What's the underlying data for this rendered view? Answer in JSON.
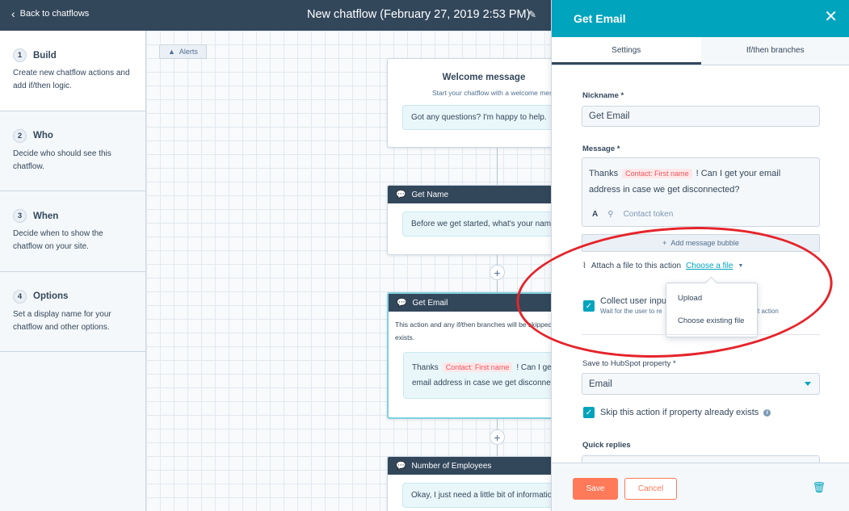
{
  "topbar": {
    "back_label": "Back to chatflows",
    "title": "New chatflow (February 27, 2019 2:53 PM)"
  },
  "steps": [
    {
      "num": "1",
      "title": "Build",
      "desc": "Create new chatflow actions and add if/then logic."
    },
    {
      "num": "2",
      "title": "Who",
      "desc": "Decide who should see this chatflow."
    },
    {
      "num": "3",
      "title": "When",
      "desc": "Decide when to show the chatflow on your site."
    },
    {
      "num": "4",
      "title": "Options",
      "desc": "Set a display name for your chatflow and other options."
    }
  ],
  "canvas": {
    "alerts_label": "Alerts",
    "welcome": {
      "title": "Welcome message",
      "subtitle": "Start your chatflow with a welcome mes",
      "bubble": "Got any questions? I'm happy to help."
    },
    "get_name": {
      "header": "Get Name",
      "bubble": "Before we get started, what's your name"
    },
    "get_email": {
      "header": "Get Email",
      "note_line1": "This action and any if/then branches will be skipped",
      "note_line2": "exists.",
      "bubble_pre": "Thanks",
      "bubble_tag": "Contact: First name",
      "bubble_post": "! Can I get",
      "bubble_line2": "email address in case we get disconnect"
    },
    "employees": {
      "header": "Number of Employees",
      "bubble": "Okay, I just need a little bit of informatio"
    }
  },
  "panel": {
    "title": "Get Email",
    "tabs": [
      "Settings",
      "If/then branches"
    ],
    "nickname_label": "Nickname *",
    "nickname_value": "Get Email",
    "message_label": "Message *",
    "message_pre": "Thanks",
    "message_tag": "Contact: First name",
    "message_post": "! Can I get your email",
    "message_line2": "address in case we get disconnected?",
    "contact_token": "Contact token",
    "add_bubble": "Add message bubble",
    "attach_label": "Attach a file to this action",
    "choose_file": "Choose a file",
    "dropdown_items": [
      "Upload",
      "Choose existing file"
    ],
    "collect_label": "Collect user inpu",
    "collect_sub": "Wait for the user to re",
    "collect_sub_tail": "t action",
    "save_property_label": "Save to HubSpot property *",
    "save_property_value": "Email",
    "skip_label": "Skip this action if property already exists",
    "quick_replies_label": "Quick replies",
    "save_button": "Save",
    "cancel_button": "Cancel"
  },
  "colors": {
    "accent": "#00a4bd",
    "save": "#ff7a59",
    "header_dark": "#33475b",
    "annotation": "#e5242b"
  }
}
